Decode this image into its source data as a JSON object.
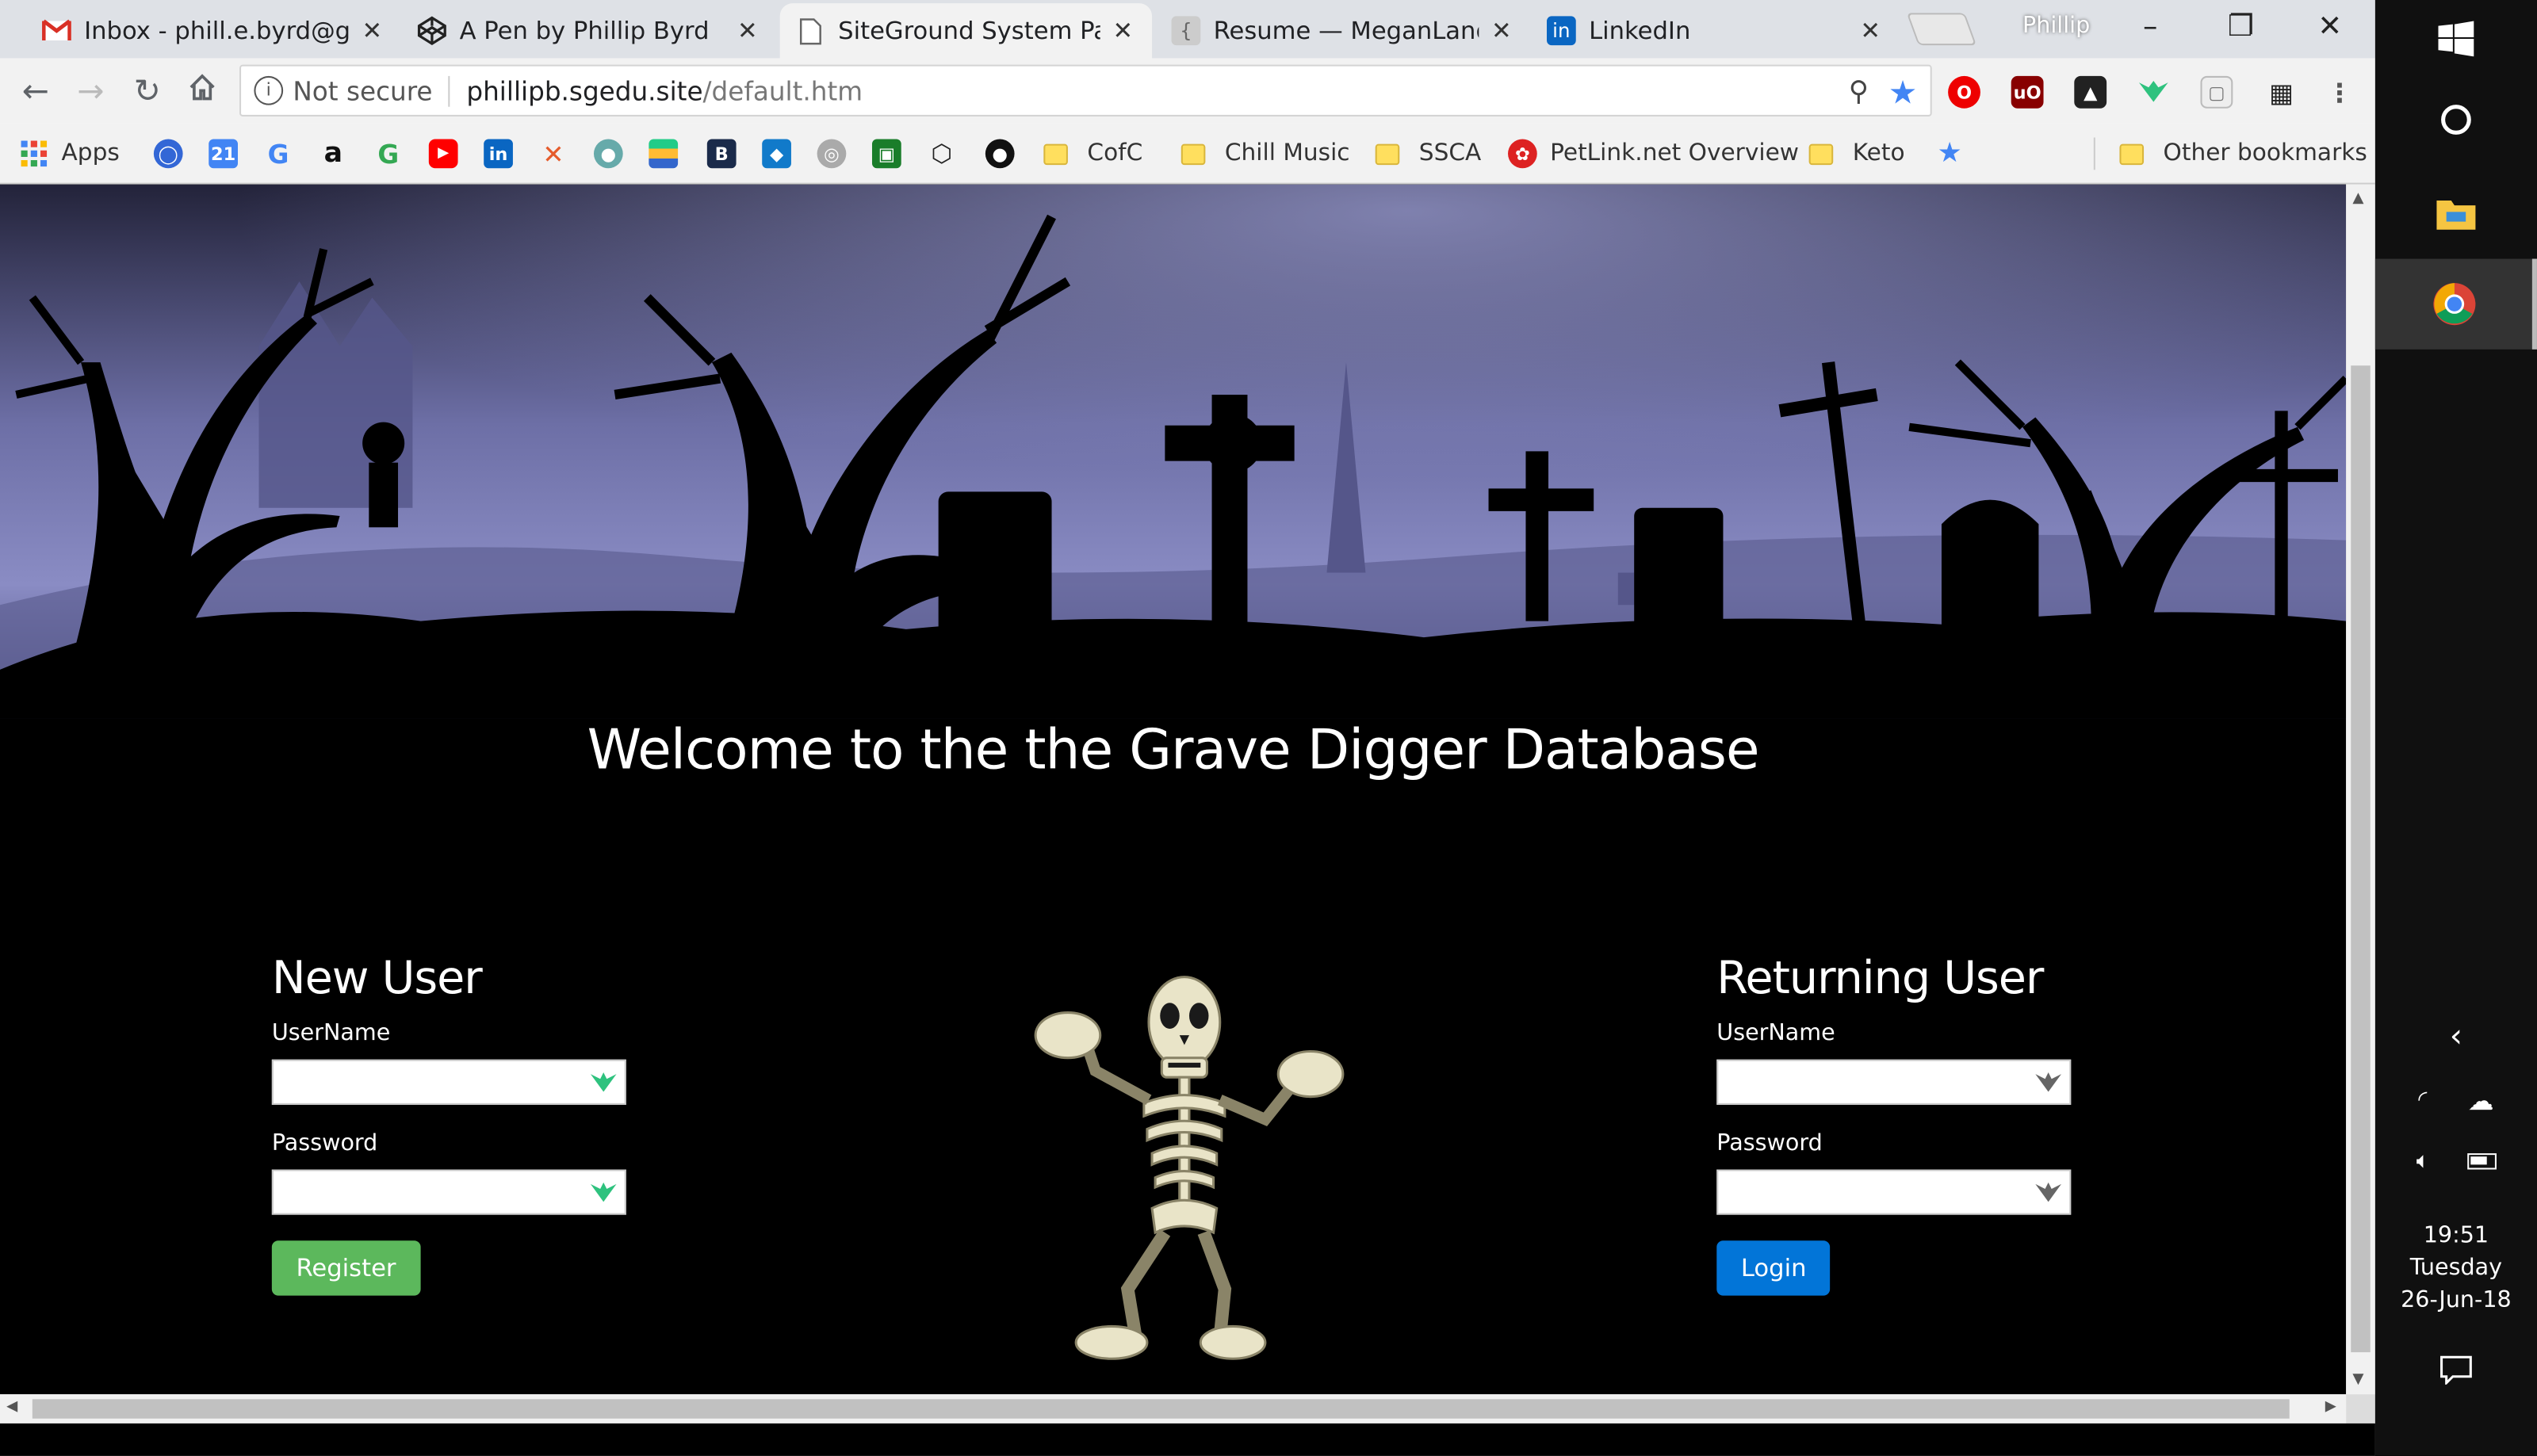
{
  "tabs": [
    {
      "title": "Inbox - phill.e.byrd@gma",
      "icon": "gmail-icon"
    },
    {
      "title": "A Pen by Phillip Byrd",
      "icon": "codepen-icon"
    },
    {
      "title": "SiteGround System Page",
      "icon": "page-icon"
    },
    {
      "title": "Resume — MeganLanda",
      "icon": "brace-icon"
    },
    {
      "title": "LinkedIn",
      "icon": "linkedin-icon"
    }
  ],
  "window": {
    "user": "Phillip"
  },
  "address": {
    "security": "Not secure",
    "host": "phillipb.sgedu.site",
    "path": "/default.htm"
  },
  "bookmarks": {
    "apps": "Apps",
    "folders": [
      "CofC",
      "Chill Music",
      "SSCA"
    ],
    "petlink": "PetLink.net Overview",
    "keto": "Keto",
    "other": "Other bookmarks",
    "calendar_day": "21"
  },
  "page": {
    "welcome": "Welcome to the the Grave Digger Database",
    "new_user": {
      "heading": "New User",
      "username_label": "UserName",
      "password_label": "Password",
      "button": "Register",
      "button_color": "#5cb85c"
    },
    "returning_user": {
      "heading": "Returning User",
      "username_label": "UserName",
      "password_label": "Password",
      "button": "Login",
      "button_color": "#0275d8"
    }
  },
  "taskbar": {
    "time": "19:51",
    "day": "Tuesday",
    "date": "26-Jun-18"
  }
}
